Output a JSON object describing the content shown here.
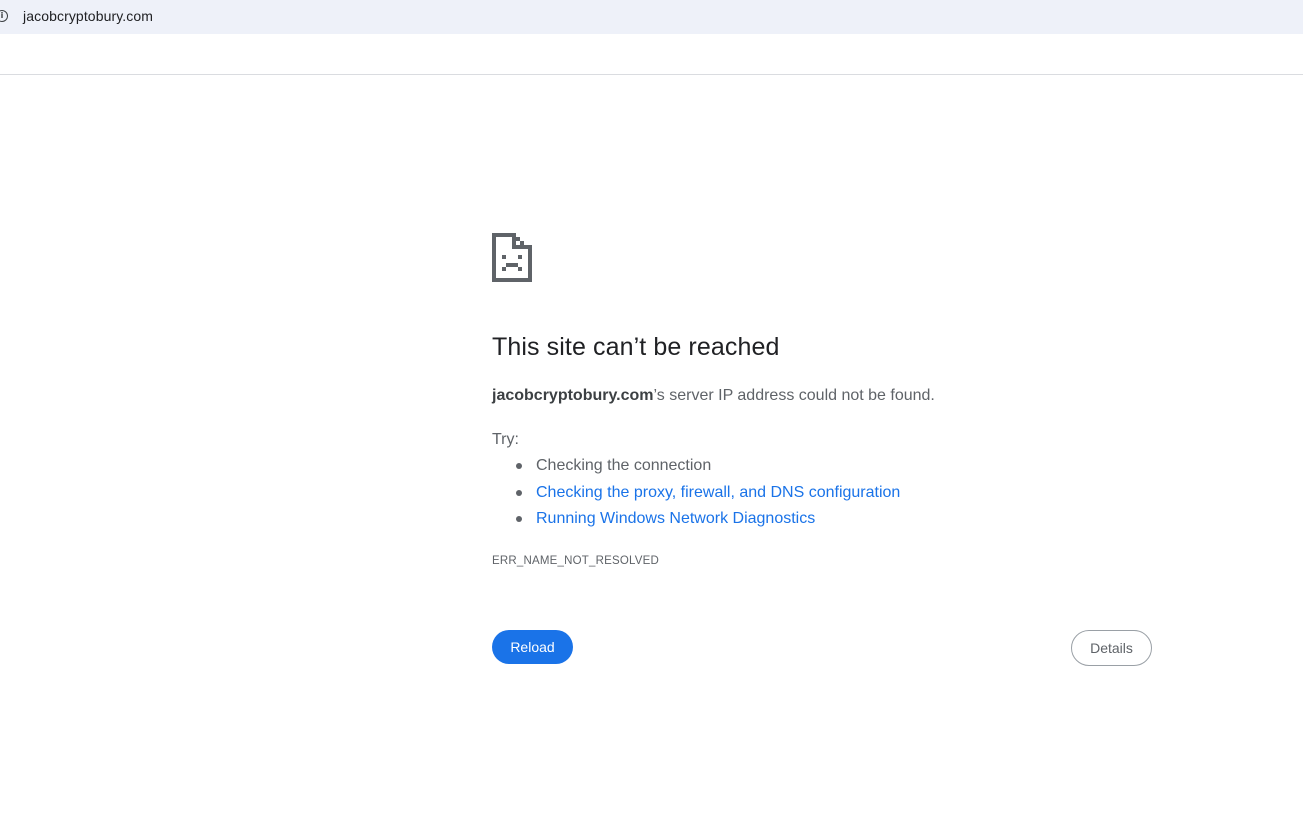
{
  "browser": {
    "url": "jacobcryptobury.com",
    "site_info_icon": "info-circle-icon"
  },
  "error_page": {
    "icon": "sad-page-icon",
    "title": "This site can’t be reached",
    "summary_host": "jacobcryptobury.com",
    "summary_rest": "’s server IP address could not be found.",
    "try_label": "Try:",
    "suggestions": [
      {
        "label": "Checking the connection",
        "is_link": false
      },
      {
        "label": "Checking the proxy, firewall, and DNS configuration",
        "is_link": true
      },
      {
        "label": "Running Windows Network Diagnostics",
        "is_link": true
      }
    ],
    "error_code": "ERR_NAME_NOT_RESOLVED",
    "reload_label": "Reload",
    "details_label": "Details"
  },
  "colors": {
    "accent": "#1a73e8",
    "omnibox_bg": "#eef1f9",
    "text_primary": "#202124",
    "text_secondary": "#5f6368"
  }
}
